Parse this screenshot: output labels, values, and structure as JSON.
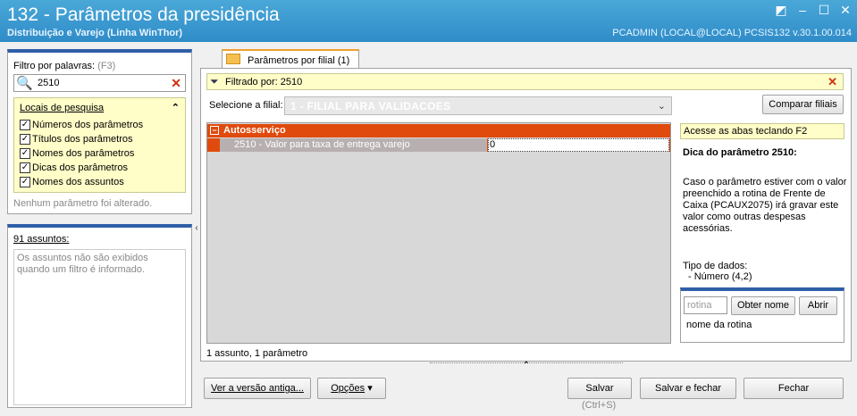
{
  "window": {
    "title": "132 - Parâmetros da presidência",
    "subtitle": "Distribuição e Varejo (Linha WinThor)",
    "user_info": "PCADMIN (LOCAL@LOCAL)   PCSIS132  v.30.1.00.014"
  },
  "left_panel": {
    "filter_label": "Filtro por palavras:",
    "filter_shortcut": "(F3)",
    "search_value": "2510",
    "locais_header": "Locais de pesquisa",
    "checkboxes": [
      {
        "label": "Números dos parâmetros",
        "checked": true
      },
      {
        "label": "Títulos dos parâmetros",
        "checked": true
      },
      {
        "label": "Nomes dos parâmetros",
        "checked": true
      },
      {
        "label": "Dicas dos parâmetros",
        "checked": true
      },
      {
        "label": "Nomes dos assuntos",
        "checked": true
      }
    ],
    "status": "Nenhum parâmetro foi alterado.",
    "assuntos_label": "91 assuntos:",
    "assuntos_note": "Os assuntos não são exibidos quando um filtro é informado."
  },
  "tab": {
    "label": "Parâmetros por filial  (1)"
  },
  "main": {
    "filter_text": "Filtrado por: 2510",
    "filial_label": "Selecione a filial:",
    "filial_value": "1 - FILIAL PARA VALIDACOES",
    "compare_button": "Comparar filiais",
    "group": "Autosserviço",
    "parameter_name": "2510 - Valor para taxa de entrega varejo",
    "parameter_value": "0",
    "grid_status": "1 assunto, 1 parâmetro"
  },
  "side": {
    "hint": "Acesse as abas teclando F2",
    "dica_title": "Dica do parâmetro 2510:",
    "dica_text": "Caso o parâmetro estiver com o valor preenchido a rotina de Frente de Caixa (PCAUX2075) irá gravar este valor como outras despesas acessórias.",
    "tipo_label": "Tipo de dados:",
    "tipo_value": "- Número (4,2)",
    "rotina_placeholder": "rotina",
    "obter_button": "Obter nome",
    "abrir_button": "Abrir",
    "nome_rotina": "nome da rotina"
  },
  "footer": {
    "ver_versao": "Ver a versão antiga...",
    "opcoes": "Opções",
    "salvar": "Salvar",
    "salvar_shortcut": "(Ctrl+S)",
    "salvar_fechar": "Salvar e fechar",
    "fechar": "Fechar"
  }
}
